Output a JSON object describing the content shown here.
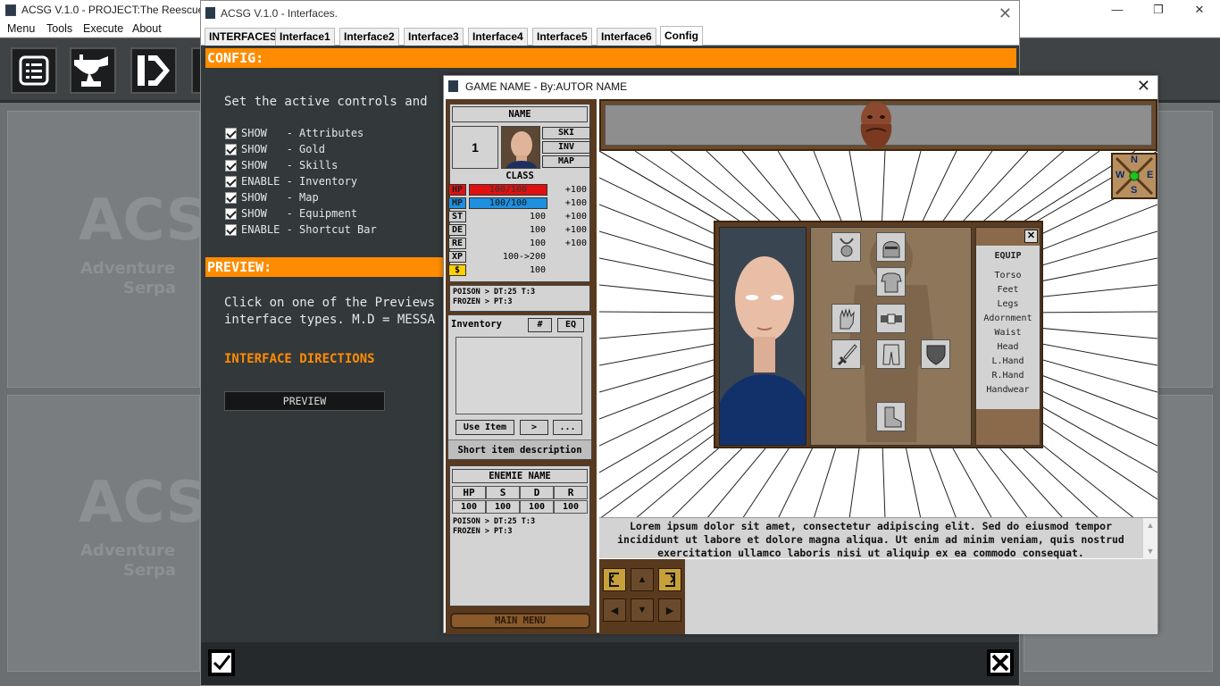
{
  "main_window": {
    "title": "ACSG V.1.0 - PROJECT:The Reescue.asg",
    "menu": [
      "Menu",
      "Tools",
      "Execute",
      "About"
    ],
    "tools": [
      "list-icon",
      "anvil-icon",
      "run-icon"
    ],
    "watermark_big": "ACSG",
    "watermark_line1": "Adventure",
    "watermark_line2": "Serpa"
  },
  "interfaces_window": {
    "title": "ACSG V.1.0 - Interfaces.",
    "tabs": [
      "INTERFACES",
      "Interface1",
      "Interface2",
      "Interface3",
      "Interface4",
      "Interface5",
      "Interface6",
      "Config"
    ],
    "active_tab": "Config",
    "config_header": "CONFIG:",
    "config_intro": "Set the active controls and",
    "checkboxes": [
      {
        "label": "SHOW   - Attributes",
        "checked": true
      },
      {
        "label": "SHOW   - Gold",
        "checked": true
      },
      {
        "label": "SHOW   - Skills",
        "checked": true
      },
      {
        "label": "ENABLE - Inventory",
        "checked": true
      },
      {
        "label": "SHOW   - Map",
        "checked": true
      },
      {
        "label": "SHOW   - Equipment",
        "checked": true
      },
      {
        "label": "ENABLE - Shortcut Bar",
        "checked": true
      }
    ],
    "preview_header": "PREVIEW:",
    "preview_text1": "Click on one of the Previews",
    "preview_text2": "interface types. M.D = MESSA",
    "interface_directions": "INTERFACE DIRECTIONS",
    "preview_button": "PREVIEW"
  },
  "game_window": {
    "title": "GAME NAME - By:AUTOR NAME",
    "char_name": "NAME",
    "level": "1",
    "side_buttons": [
      "SKI",
      "INV",
      "MAP"
    ],
    "class_label": "CLASS",
    "hp": {
      "label": "HP",
      "value": "100/100",
      "bonus": "+100",
      "fill": 1.0,
      "color": "#e01010"
    },
    "mp": {
      "label": "MP",
      "value": "100/100",
      "bonus": "+100",
      "fill": 1.0,
      "color": "#1e90e0"
    },
    "stats": [
      {
        "label": "ST",
        "value": "100",
        "bonus": "+100"
      },
      {
        "label": "DE",
        "value": "100",
        "bonus": "+100"
      },
      {
        "label": "RE",
        "value": "100",
        "bonus": "+100"
      },
      {
        "label": "XP",
        "value": "100->200",
        "bonus": ""
      },
      {
        "label": "$",
        "value": "100",
        "bonus": ""
      }
    ],
    "status_effects": [
      "POISON > DT:25 T:3",
      "FROZEN > PT:3"
    ],
    "inventory_label": "Inventory",
    "inv_hash_btn": "#",
    "inv_eq_btn": "EQ",
    "use_item_btn": "Use Item",
    "next_btn": ">",
    "more_btn": "...",
    "short_desc": "Short item description",
    "enemy_name": "ENEMIE NAME",
    "enemy_headers": [
      "HP",
      "S",
      "D",
      "R"
    ],
    "enemy_values": [
      "100",
      "100",
      "100",
      "100"
    ],
    "enemy_status": [
      "POISON > DT:25 T:3",
      "FROZEN > PT:3"
    ],
    "main_menu_btn": "MAIN MENU",
    "compass": {
      "n": "N",
      "s": "S",
      "e": "E",
      "w": "W"
    },
    "equip_title": "EQUIP",
    "equip_close": "✕",
    "equip_items": [
      "Torso",
      "Feet",
      "Legs",
      "Adornment",
      "Waist",
      "Head",
      "L.Hand",
      "R.Hand",
      "Handwear"
    ],
    "message": "Lorem ipsum dolor sit amet, consectetur adipiscing elit. Sed do eiusmod tempor incididunt ut labore et dolore magna aliqua. Ut enim ad minim veniam, quis nostrud exercitation ullamco laboris nisi ut aliquip ex ea commodo consequat.",
    "scroll_up": "▲",
    "scroll_down": "▼"
  }
}
